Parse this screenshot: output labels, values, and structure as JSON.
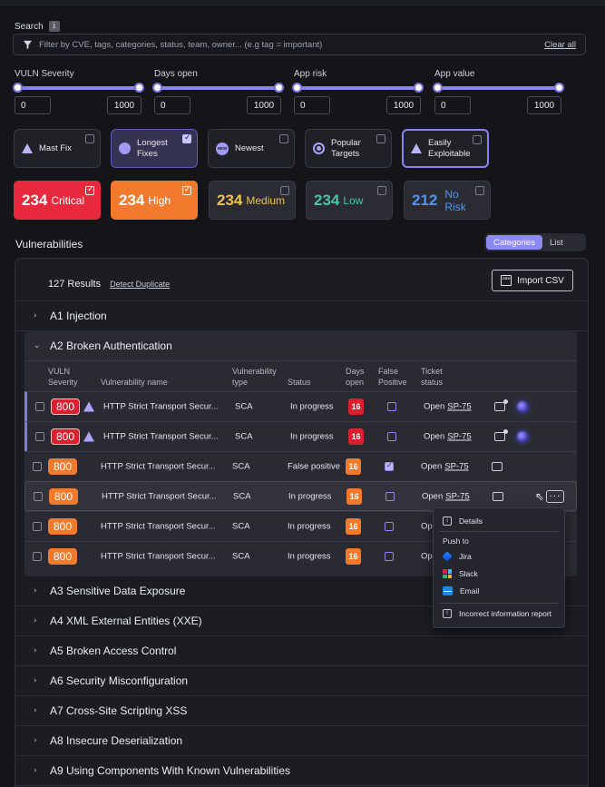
{
  "search": {
    "label": "Search",
    "placeholder": "Filter by CVE, tags, categories, status, team, owner... (e.g tag = important)",
    "clear_label": "Clear all"
  },
  "sliders": [
    {
      "label": "VULN Severity",
      "min": "0",
      "max": "1000"
    },
    {
      "label": "Days open",
      "min": "0",
      "max": "1000"
    },
    {
      "label": "App risk",
      "min": "0",
      "max": "1000"
    },
    {
      "label": "App value",
      "min": "0",
      "max": "1000"
    }
  ],
  "quick_filters": [
    {
      "label": "Mast Fix",
      "icon": "warning-icon",
      "checked": false
    },
    {
      "label": "Longest Fixes",
      "icon": "clock-icon",
      "checked": true
    },
    {
      "label": "Newest",
      "icon": "new-icon",
      "checked": false
    },
    {
      "label": "Popular Targets",
      "icon": "target-icon",
      "checked": false
    },
    {
      "label": "Easily Exploitable",
      "icon": "warning-icon",
      "checked": false
    }
  ],
  "severity_filters": [
    {
      "count": "234",
      "level": "Critical",
      "checked": true,
      "color": "#e8283c"
    },
    {
      "count": "234",
      "level": "High",
      "checked": true,
      "color": "#f27a2c"
    },
    {
      "count": "234",
      "level": "Medium",
      "checked": false,
      "color": "#f0c44a"
    },
    {
      "count": "234",
      "level": "Low",
      "checked": false,
      "color": "#44c8a0"
    },
    {
      "count": "212",
      "level": "No Risk",
      "checked": false,
      "color": "#4f94ee"
    }
  ],
  "vulnerabilities": {
    "title": "Vulnerabilities",
    "view_toggle": [
      "Categories",
      "List"
    ],
    "active_view": "Categories",
    "results": "127 Results",
    "detect_duplicate": "Detect Duplicate",
    "import_csv": "Import CSV",
    "csv_icon_text": "CSV",
    "categories": [
      "A1 Injection",
      "A2 Broken Authentication",
      "A3 Sensitive Data Exposure",
      "A4 XML External Entities (XXE)",
      "A5 Broken Access Control",
      "A6 Security Misconfiguration",
      "A7 Cross-Site Scripting XSS",
      "A8 Insecure Deserialization",
      "A9 Using Components With Known Vulnerabilities"
    ],
    "expanded_category": "A2 Broken Authentication",
    "columns": {
      "severity": [
        "VULN",
        "Severity"
      ],
      "name": "Vulnerability name",
      "type": [
        "Vulnerability",
        "type"
      ],
      "status": "Status",
      "days": [
        "Days",
        "open"
      ],
      "fp": [
        "False",
        "Positive"
      ],
      "ticket": [
        "Ticket",
        "status"
      ]
    },
    "rows": [
      {
        "severity": "800",
        "name": "HTTP Strict Transport Secur...",
        "type": "SCA",
        "status": "In progress",
        "days": "16",
        "fp": false,
        "ticket_status": "Open",
        "ticket_id": "SP-75"
      },
      {
        "severity": "800",
        "name": "HTTP Strict Transport Secur...",
        "type": "SCA",
        "status": "In progress",
        "days": "16",
        "fp": false,
        "ticket_status": "Open",
        "ticket_id": "SP-75"
      },
      {
        "severity": "800",
        "name": "HTTP Strict Transport Secur...",
        "type": "SCA",
        "status": "False positive",
        "days": "16",
        "fp": true,
        "ticket_status": "Open",
        "ticket_id": "SP-75"
      },
      {
        "severity": "800",
        "name": "HTTP Strict Transport Secur...",
        "type": "SCA",
        "status": "In progress",
        "days": "16",
        "fp": false,
        "ticket_status": "Open",
        "ticket_id": "SP-75"
      },
      {
        "severity": "800",
        "name": "HTTP Strict Transport Secur...",
        "type": "SCA",
        "status": "In progress",
        "days": "16",
        "fp": false,
        "ticket_status": "Op",
        "ticket_id": ""
      },
      {
        "severity": "800",
        "name": "HTTP Strict Transport Secur...",
        "type": "SCA",
        "status": "In progress",
        "days": "16",
        "fp": false,
        "ticket_status": "Op",
        "ticket_id": ""
      }
    ]
  },
  "context_menu": {
    "details": "Details",
    "push_to": "Push to",
    "jira": "Jira",
    "slack": "Slack",
    "email": "Email",
    "report": "Incorrect information report",
    "info_glyph": "i",
    "report_glyph": "!"
  },
  "info_glyph": "i",
  "new_icon_text": "NEW",
  "more_glyph": "···",
  "cursor_glyph": "⇖",
  "chevron_right": "›",
  "chevron_down": "⌄"
}
